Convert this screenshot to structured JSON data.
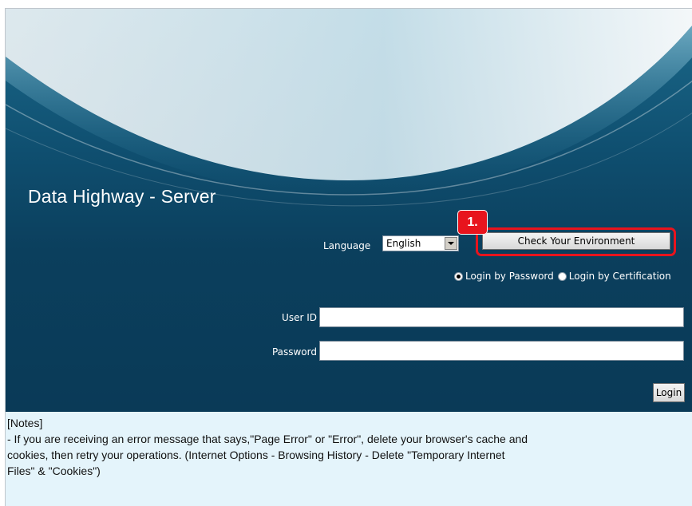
{
  "header": {
    "title": "Data Highway - Server"
  },
  "language": {
    "label": "Language",
    "selected": "English"
  },
  "check_environment": {
    "label": "Check Your Environment",
    "step_badge": "1."
  },
  "login_mode": {
    "password_option": "Login by Password",
    "certification_option": "Login by Certification",
    "selected": "password"
  },
  "form": {
    "user_id_label": "User ID",
    "user_id_value": "",
    "password_label": "Password",
    "password_value": "",
    "login_label": "Login"
  },
  "notes": {
    "heading": "[Notes]",
    "line1": "- If you are receiving an error message that says,\"Page Error\" or \"Error\", delete your browser's cache and",
    "line2": "cookies, then retry your operations. (Internet Options - Browsing History - Delete \"Temporary Internet",
    "line3": "Files\" & \"Cookies\")"
  },
  "colors": {
    "highlight": "#e8141d",
    "hero_dark": "#0b3f5d",
    "notes_bg": "#e4f4fb"
  }
}
